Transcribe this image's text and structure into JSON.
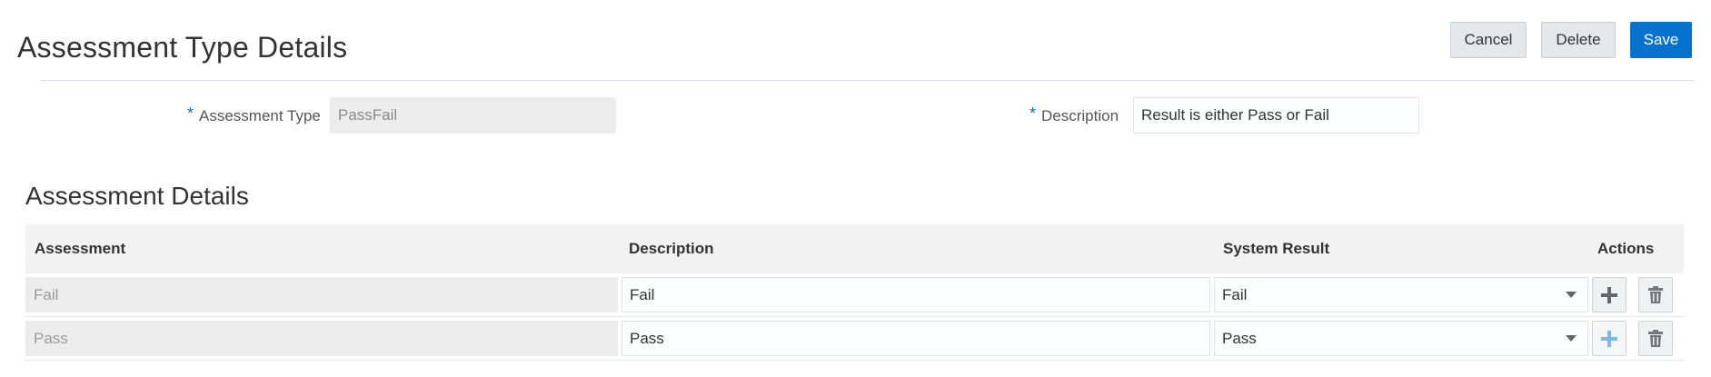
{
  "page": {
    "title": "Assessment Type Details"
  },
  "header_actions": {
    "cancel": "Cancel",
    "delete": "Delete",
    "save": "Save"
  },
  "form": {
    "assessment_type": {
      "required_mark": "*",
      "label": "Assessment Type",
      "value": "PassFail"
    },
    "description": {
      "required_mark": "*",
      "label": "Description",
      "value": "Result is either Pass or Fail"
    }
  },
  "details": {
    "title": "Assessment Details",
    "columns": {
      "assessment": "Assessment",
      "description": "Description",
      "system_result": "System Result",
      "actions": "Actions"
    },
    "rows": [
      {
        "assessment": "Fail",
        "description": "Fail",
        "system_result": "Fail",
        "add_icon": "plus-icon",
        "delete_icon": "trash-icon",
        "add_icon_color": "#666666"
      },
      {
        "assessment": "Pass",
        "description": "Pass",
        "system_result": "Pass",
        "add_icon": "plus-icon",
        "delete_icon": "trash-icon",
        "add_icon_color": "#7fb6e6"
      }
    ]
  },
  "colors": {
    "accent": "#0572ce",
    "readonly_bg": "#ececec",
    "header_bg": "#f2f2f2"
  }
}
